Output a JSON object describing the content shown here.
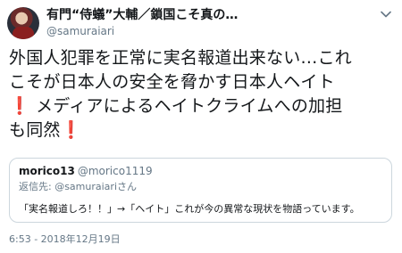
{
  "author": {
    "display_name": "有門“侍蟻”大輔／鎖国こそ真の…",
    "handle": "@samuraiari"
  },
  "tweet": {
    "line1": "外国人犯罪を正常に実名報道出来ない…これ",
    "line2": "こそが日本人の安全を脅かす日本人ヘイト",
    "line3_excl": "❗",
    "line3": " メディアによるヘイトクライムへの加担",
    "line4": "も同然",
    "line4_excl": "❗"
  },
  "quoted": {
    "name": "morico13",
    "handle": "@morico1119",
    "reply_to": "返信先: @samuraiariさん",
    "text": "「実名報道しろ！！」→「ヘイト」これが今の異常な現状を物語っています。"
  },
  "timestamp": "6:53 - 2018年12月19日",
  "colors": {
    "text": "#14171a",
    "muted": "#657786",
    "border": "#ccd6dd",
    "emoji_red": "#e0245e"
  },
  "icons": {
    "menu": "chevron-down-icon"
  }
}
